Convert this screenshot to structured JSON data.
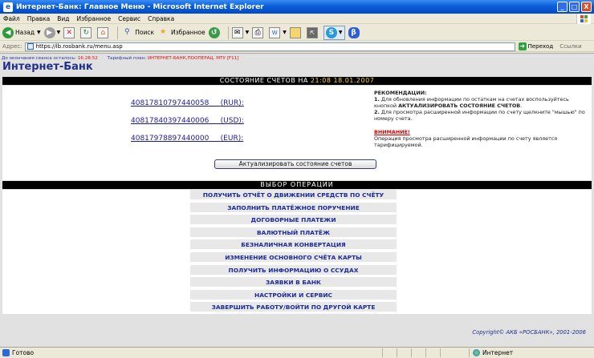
{
  "window": {
    "title": "Интернет-Банк: Главное Меню - Microsoft Internet Explorer",
    "buttons": {
      "minimize": "_",
      "maximize": "□",
      "close": "X"
    }
  },
  "menu": [
    "Файл",
    "Правка",
    "Вид",
    "Избранное",
    "Сервис",
    "Справка"
  ],
  "toolbar": {
    "back": "Назад",
    "search": "Поиск",
    "favorites": "Избранное"
  },
  "address": {
    "label": "Адрес:",
    "url": "https://ib.rosbank.ru/menu.asp",
    "go": "Переход",
    "links": "Ссылки"
  },
  "session": {
    "remaining_label": "До окончания сеанса осталось:",
    "remaining_value": "16:28:52",
    "tariff_label": "Тарифный план:",
    "tariff_value": "ИНТЕРНЕТ-БАНК,ПООПЕРАЦ. МТУ [F11]"
  },
  "page": {
    "app_title": "Интернет-Банк",
    "accounts_header": "СОСТОЯНИЕ СЧЕТОВ НА",
    "accounts_time": "21:08  18.01.2007",
    "accounts": [
      {
        "number": "40817810797440058",
        "currency": "(RUR):"
      },
      {
        "number": "40817840397440006",
        "currency": "(USD):"
      },
      {
        "number": "40817978897440000",
        "currency": "(EUR):"
      }
    ],
    "recommendations": {
      "title": "РЕКОМЕНДАЦИИ:",
      "item1_num": "1.",
      "item1_text": "Для обновления информации по остаткам на счетах воспользуйтесь кнопкой",
      "item1_bold": "АКТУАЛИЗИРОВАТЬ СОСТОЯНИЕ СЧЕТОВ",
      "item2_num": "2.",
      "item2_text": "Для просмотра расширенной информации по счету щелкните \"мышью\" по номеру счета.",
      "warning_title": "ВНИМАНИЕ!",
      "warning_text": "Операция просмотра расширенной информации по счету является тарифицируемой."
    },
    "refresh_button": "Актуализировать состояние счетов",
    "ops_header": "ВЫБОР  ОПЕРАЦИИ",
    "operations": [
      "ПОЛУЧИТЬ ОТЧЁТ О ДВИЖЕНИИ СРЕДСТВ ПО СЧЁТУ",
      "ЗАПОЛНИТЬ ПЛАТЁЖНОЕ ПОРУЧЕНИЕ",
      "ДОГОВОРНЫЕ ПЛАТЕЖИ",
      "ВАЛЮТНЫЙ ПЛАТЁЖ",
      "БЕЗНАЛИЧНАЯ КОНВЕРТАЦИЯ",
      "ИЗМЕНЕНИЕ ОСНОВНОГО СЧЁТА КАРТЫ",
      "ПОЛУЧИТЬ ИНФОРМАЦИЮ О ССУДАХ",
      "ЗАЯВКИ В БАНК",
      "НАСТРОЙКИ И СЕРВИС",
      "ЗАВЕРШИТЬ РАБОТУ/ВОЙТИ ПО ДРУГОЙ КАРТЕ"
    ],
    "copyright": "Copyright© АКБ «РОСБАНК», 2001-2006"
  },
  "status": {
    "text": "Готово",
    "zone": "Интернет"
  },
  "colors": {
    "accent": "#20308f",
    "header_bar": "#000000",
    "header_time": "#ffdd00",
    "warning": "#dd0000"
  }
}
